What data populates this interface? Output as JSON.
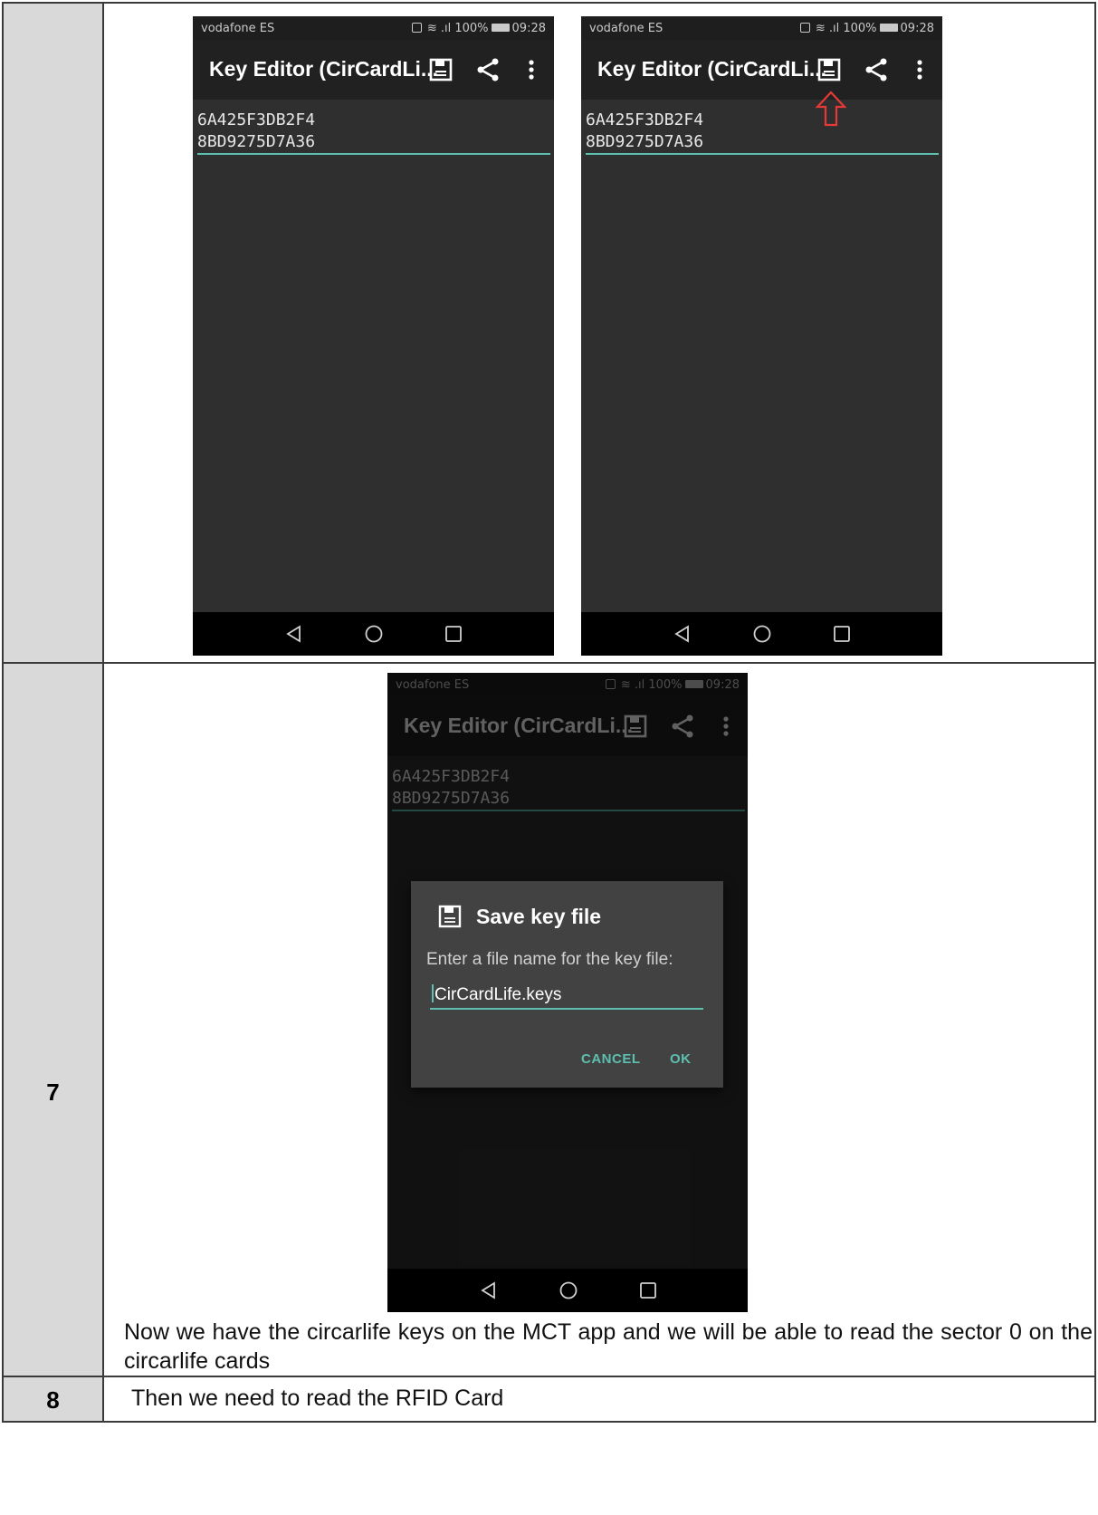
{
  "steps": {
    "first": {
      "number": ""
    },
    "seven": {
      "number": "7",
      "caption": "Now we have the circarlife keys on the MCT app and we will be able to read the sector 0 on the circarlife cards"
    },
    "eight": {
      "number": "8",
      "caption": "Then we need to read the RFID Card"
    }
  },
  "phone": {
    "carrier": "vodafone ES",
    "signal_text": "100%",
    "time": "09:28",
    "app_title": "Key Editor (CirCardLi...",
    "save_icon": "save-icon",
    "share_icon": "share-icon",
    "menu_icon": "more-vert-icon",
    "keys": [
      "6A425F3DB2F4",
      "8BD9275D7A36"
    ],
    "nav": [
      "back-icon",
      "home-icon",
      "recents-icon"
    ]
  },
  "dialog": {
    "title": "Save key file",
    "message": "Enter a file name for the key file:",
    "input_value": "CirCardLife.keys",
    "cancel_label": "CANCEL",
    "ok_label": "OK"
  },
  "colors": {
    "accent": "#5cbfb0",
    "arrow": "#e53935",
    "step_column": "#d9d9d9"
  }
}
